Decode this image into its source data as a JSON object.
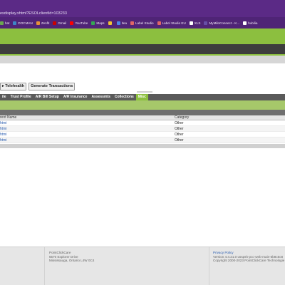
{
  "browser": {
    "url": "esdisplay.xhtml?ESOLclientId=103233",
    "bookmarks": [
      {
        "label": "hat",
        "color": "#6aa84f"
      },
      {
        "label": "DOCMAN",
        "color": "#3d85c6"
      },
      {
        "label": "Zenfit",
        "color": "#e69138"
      },
      {
        "label": "Gmail",
        "color": "#cc0000"
      },
      {
        "label": "YouTube",
        "color": "#ff0000"
      },
      {
        "label": "Maps",
        "color": "#34a853"
      },
      {
        "label": "",
        "color": "#f1c232"
      },
      {
        "label": "Ilea",
        "color": "#4a86e8"
      },
      {
        "label": "Label Studio",
        "color": "#e06666"
      },
      {
        "label": "Label Studio EU",
        "color": "#e06666"
      },
      {
        "label": "XLS",
        "color": "#ffffff"
      },
      {
        "label": "MyMiloConnect - K...",
        "color": "#674ea7"
      },
      {
        "label": "hubilia",
        "color": "#ffffff"
      }
    ]
  },
  "actions": {
    "telehealth_label": "Telehealth",
    "generate_transactions_label": "Generate Transactions"
  },
  "tabs": [
    {
      "label": "ile",
      "active": false
    },
    {
      "label": "Trust Profile",
      "active": false
    },
    {
      "label": "A/R Bill Setup",
      "active": false
    },
    {
      "label": "A/R Insurance",
      "active": false
    },
    {
      "label": "Assessmts",
      "active": false
    },
    {
      "label": "Collections",
      "active": false
    },
    {
      "label": "Misc",
      "active": true
    }
  ],
  "table": {
    "headers": [
      "rent Name",
      "Category"
    ],
    "rows": [
      [
        "htmi",
        "Other"
      ],
      [
        "htmi",
        "Other"
      ],
      [
        "htmi",
        "Other"
      ],
      [
        "htmi",
        "Other"
      ]
    ]
  },
  "footer": {
    "company": "PointClickCare",
    "address1": "5570 Explorer Drive",
    "address2": "Mississauga, Ontario L4W 0C4",
    "privacy": "Privacy Policy",
    "version": "Version 4.4.21.0 usspsh-pcc-web-main-5b8c5c8",
    "copyright": "Copyright 2000-2023 PointClickCare Technologie"
  }
}
